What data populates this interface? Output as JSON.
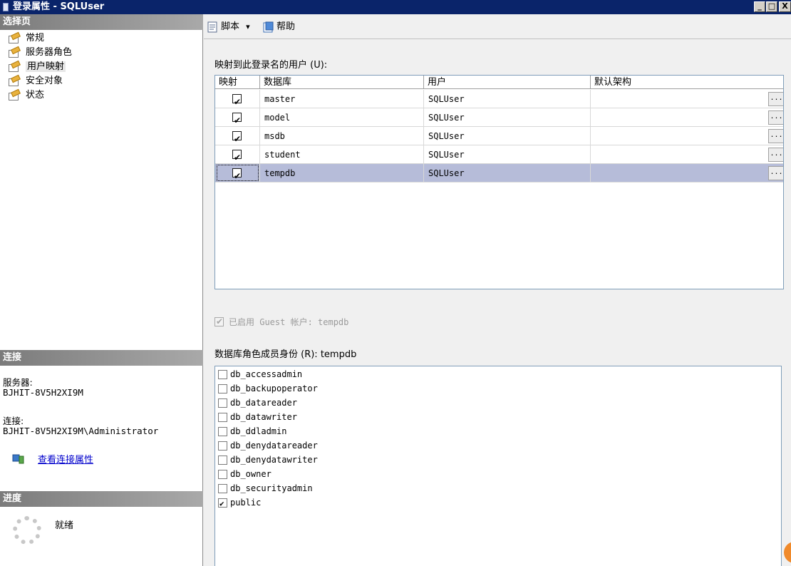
{
  "window": {
    "title": "登录属性 - SQLUser",
    "min": "_",
    "max": "□",
    "close": "X"
  },
  "left": {
    "select_page_header": "选择页",
    "pages": [
      {
        "label": "常规",
        "selected": false
      },
      {
        "label": "服务器角色",
        "selected": false
      },
      {
        "label": "用户映射",
        "selected": true
      },
      {
        "label": "安全对象",
        "selected": false
      },
      {
        "label": "状态",
        "selected": false
      }
    ],
    "connection_header": "连接",
    "server_label": "服务器:",
    "server_value": "BJHIT-8V5H2XI9M",
    "connection_label": "连接:",
    "connection_value": "BJHIT-8V5H2XI9M\\Administrator",
    "view_connection_link": "查看连接属性",
    "progress_header": "进度",
    "progress_status": "就绪"
  },
  "toolbar": {
    "script_label": "脚本",
    "script_arrow": "▾",
    "help_label": "帮助"
  },
  "mapping": {
    "section_label": "映射到此登录名的用户 (U):",
    "columns": [
      "映射",
      "数据库",
      "用户",
      "默认架构"
    ],
    "rows": [
      {
        "mapped": true,
        "database": "master",
        "user": "SQLUser",
        "schema": "",
        "selected": false
      },
      {
        "mapped": true,
        "database": "model",
        "user": "SQLUser",
        "schema": "",
        "selected": false
      },
      {
        "mapped": true,
        "database": "msdb",
        "user": "SQLUser",
        "schema": "",
        "selected": false
      },
      {
        "mapped": true,
        "database": "student",
        "user": "SQLUser",
        "schema": "",
        "selected": false
      },
      {
        "mapped": true,
        "database": "tempdb",
        "user": "SQLUser",
        "schema": "",
        "selected": true
      }
    ],
    "ellipsis": "..."
  },
  "guest": {
    "label": "已启用 Guest 帐户: tempdb",
    "checked": true,
    "enabled": false
  },
  "roles": {
    "section_label": "数据库角色成员身份 (R): tempdb",
    "items": [
      {
        "name": "db_accessadmin",
        "checked": false
      },
      {
        "name": "db_backupoperator",
        "checked": false
      },
      {
        "name": "db_datareader",
        "checked": false
      },
      {
        "name": "db_datawriter",
        "checked": false
      },
      {
        "name": "db_ddladmin",
        "checked": false
      },
      {
        "name": "db_denydatareader",
        "checked": false
      },
      {
        "name": "db_denydatawriter",
        "checked": false
      },
      {
        "name": "db_owner",
        "checked": false
      },
      {
        "name": "db_securityadmin",
        "checked": false
      },
      {
        "name": "public",
        "checked": true
      }
    ]
  }
}
